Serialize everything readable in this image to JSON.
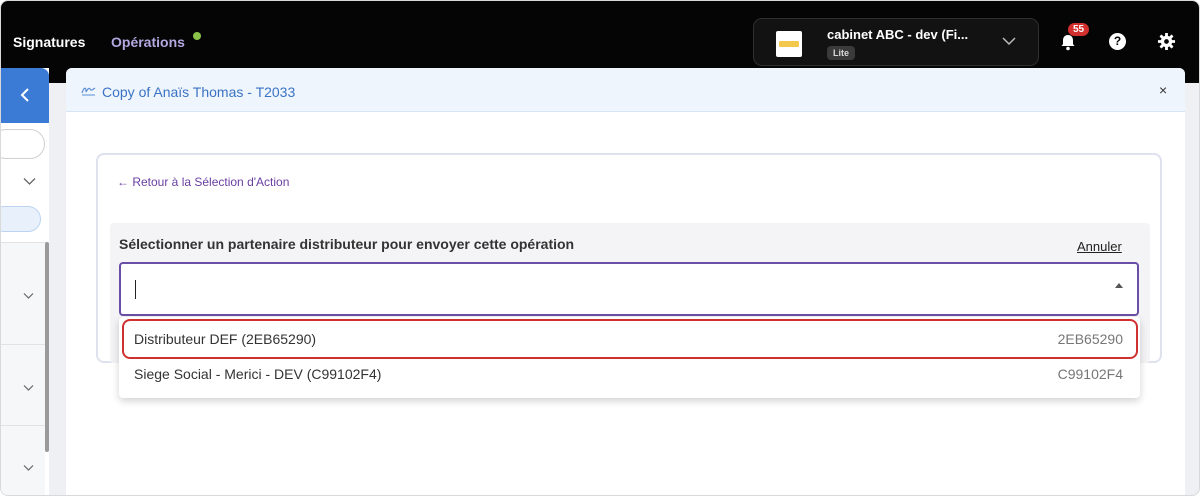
{
  "topbar": {
    "nav": [
      {
        "label": "Signatures"
      },
      {
        "label": "Opérations"
      }
    ],
    "cabinet": {
      "name": "cabinet ABC - dev (Fi...",
      "badge": "Lite"
    },
    "notifications_count": "55",
    "help_label": "?"
  },
  "modal": {
    "title": "Copy of Anaïs Thomas - T2033",
    "close_label": "×",
    "back_link": "← Retour à la Sélection d'Action",
    "select_label": "Sélectionner un partenaire distributeur pour envoyer cette opération",
    "cancel_label": "Annuler",
    "select_value": "",
    "options": [
      {
        "name": "Distributeur DEF (2EB65290)",
        "code": "2EB65290"
      },
      {
        "name": "Siege Social - Merici - DEV (C99102F4)",
        "code": "C99102F4"
      }
    ]
  },
  "colors": {
    "topbar_bg": "#050505",
    "accent_purple": "#6b4fa6",
    "highlight_red": "#d03030",
    "link_blue": "#3b73c4",
    "badge_red": "#d32f2f"
  }
}
